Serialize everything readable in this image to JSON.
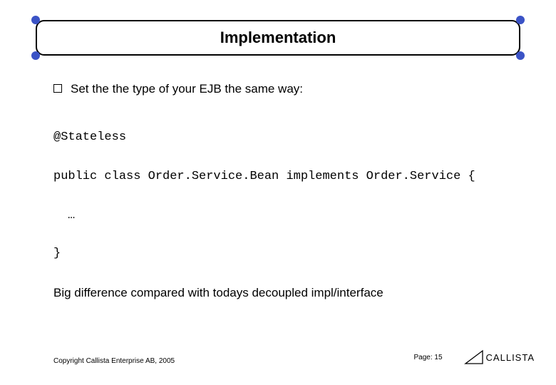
{
  "title": "Implementation",
  "bullet": "Set the the type of your EJB the same way:",
  "code": {
    "line1": "@Stateless",
    "line2": "public class Order.Service.Bean implements Order.Service {",
    "line3": "…",
    "line4": "}"
  },
  "note": "Big difference compared with todays decoupled impl/interface",
  "footer": {
    "copyright": "Copyright Callista Enterprise AB, 2005",
    "page_label": "Page: 15",
    "logo_text": "CALLISTA"
  }
}
